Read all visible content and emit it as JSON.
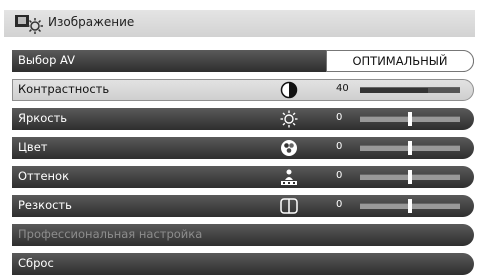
{
  "header": {
    "title": "Изображение",
    "icon": "picture-settings-icon"
  },
  "menu": [
    {
      "label": "Выбор AV",
      "type": "select",
      "value": "ОПТИМАЛЬНЫЙ"
    },
    {
      "label": "Контрастность",
      "type": "slider",
      "icon": "contrast-icon",
      "value": "40",
      "level": 0.68,
      "selected": true
    },
    {
      "label": "Яркость",
      "type": "slider",
      "icon": "brightness-icon",
      "value": "0",
      "level": 0.5
    },
    {
      "label": "Цвет",
      "type": "slider",
      "icon": "color-icon",
      "value": "0",
      "level": 0.5
    },
    {
      "label": "Оттенок",
      "type": "slider",
      "icon": "tint-icon",
      "value": "0",
      "level": 0.5
    },
    {
      "label": "Резкость",
      "type": "slider",
      "icon": "sharpness-icon",
      "value": "0",
      "level": 0.5
    },
    {
      "label": "Профессиональная настройка",
      "type": "item",
      "disabled": true
    },
    {
      "label": "Сброс",
      "type": "item"
    }
  ],
  "colors": {
    "row_dark": "#3e3e3e",
    "row_selected": "#d9d9d9",
    "disabled_text": "#8d8d8d"
  }
}
